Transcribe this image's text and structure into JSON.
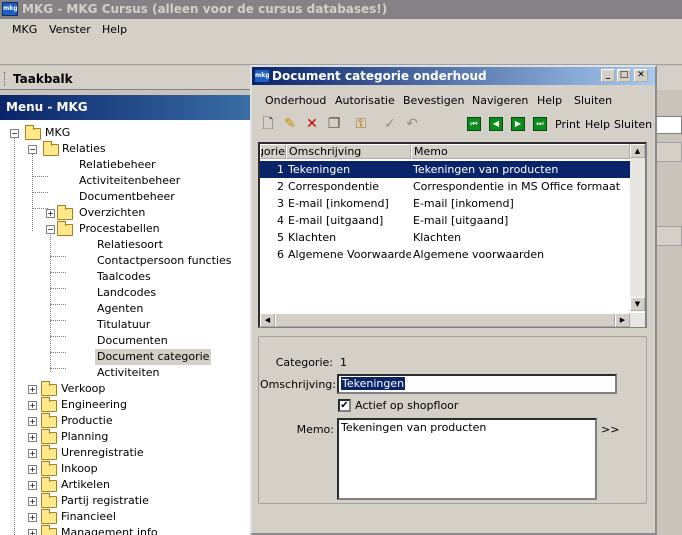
{
  "app": {
    "title": "MKG - MKG Cursus (alleen voor de cursus databases!)",
    "icon_label": "mkg",
    "menu": [
      "MKG",
      "Venster",
      "Help"
    ]
  },
  "taakbalk": {
    "title": "Taakbalk"
  },
  "left_menu": {
    "header": "Menu - MKG",
    "tree": [
      {
        "label": "MKG",
        "level": 0,
        "type": "folder",
        "expanded": true
      },
      {
        "label": "Relaties",
        "level": 1,
        "type": "folder",
        "expanded": true
      },
      {
        "label": "Relatiebeheer",
        "level": 2,
        "type": "item"
      },
      {
        "label": "Activiteitenbeheer",
        "level": 2,
        "type": "item"
      },
      {
        "label": "Documentbeheer",
        "level": 2,
        "type": "item"
      },
      {
        "label": "Overzichten",
        "level": 2,
        "type": "folder",
        "expanded": false
      },
      {
        "label": "Procestabellen",
        "level": 2,
        "type": "folder",
        "expanded": true
      },
      {
        "label": "Relatiesoort",
        "level": 3,
        "type": "item"
      },
      {
        "label": "Contactpersoon functies",
        "level": 3,
        "type": "item"
      },
      {
        "label": "Taalcodes",
        "level": 3,
        "type": "item"
      },
      {
        "label": "Landcodes",
        "level": 3,
        "type": "item"
      },
      {
        "label": "Agenten",
        "level": 3,
        "type": "item"
      },
      {
        "label": "Titulatuur",
        "level": 3,
        "type": "item"
      },
      {
        "label": "Documenten",
        "level": 3,
        "type": "item"
      },
      {
        "label": "Document categorie",
        "level": 3,
        "type": "item",
        "selected": true
      },
      {
        "label": "Activiteiten",
        "level": 3,
        "type": "item"
      },
      {
        "label": "Verkoop",
        "level": 1,
        "type": "folder",
        "expanded": false
      },
      {
        "label": "Engineering",
        "level": 1,
        "type": "folder",
        "expanded": false
      },
      {
        "label": "Productie",
        "level": 1,
        "type": "folder",
        "expanded": false
      },
      {
        "label": "Planning",
        "level": 1,
        "type": "folder",
        "expanded": false
      },
      {
        "label": "Urenregistratie",
        "level": 1,
        "type": "folder",
        "expanded": false
      },
      {
        "label": "Inkoop",
        "level": 1,
        "type": "folder",
        "expanded": false
      },
      {
        "label": "Artikelen",
        "level": 1,
        "type": "folder",
        "expanded": false
      },
      {
        "label": "Partij registratie",
        "level": 1,
        "type": "folder",
        "expanded": false
      },
      {
        "label": "Financieel",
        "level": 1,
        "type": "folder",
        "expanded": false
      },
      {
        "label": "Management info",
        "level": 1,
        "type": "folder",
        "expanded": false
      }
    ]
  },
  "dialog": {
    "title": "Document categorie onderhoud",
    "icon_label": "mkg",
    "menu": [
      "Onderhoud",
      "Autorisatie",
      "Bevestigen",
      "Navigeren",
      "Help",
      "Sluiten"
    ],
    "toolbar": {
      "icons": [
        {
          "name": "new-document-icon",
          "glyph": "🗋"
        },
        {
          "name": "edit-pencil-icon",
          "glyph": "✎"
        },
        {
          "name": "delete-x-icon",
          "glyph": "✕"
        },
        {
          "name": "copy-icon",
          "glyph": "❐"
        },
        {
          "name": "keys-icon",
          "glyph": "⚿"
        },
        {
          "name": "confirm-check-icon",
          "glyph": "✓"
        },
        {
          "name": "undo-icon",
          "glyph": "↶"
        }
      ],
      "nav": [
        {
          "name": "first-record-icon",
          "glyph": "⏮"
        },
        {
          "name": "prev-record-icon",
          "glyph": "◀"
        },
        {
          "name": "next-record-icon",
          "glyph": "▶"
        },
        {
          "name": "last-record-icon",
          "glyph": "⏭"
        }
      ],
      "print": "Print",
      "help": "Help",
      "close": "Sluiten"
    },
    "grid": {
      "columns": [
        "Categorie",
        "Omschrijving",
        "Memo"
      ],
      "rows": [
        {
          "nr": "1",
          "omschrijving": "Tekeningen",
          "memo": "Tekeningen van producten",
          "active": true
        },
        {
          "nr": "2",
          "omschrijving": "Correspondentie",
          "memo": "Correspondentie in MS Office formaat"
        },
        {
          "nr": "3",
          "omschrijving": "E-mail [inkomend]",
          "memo": "E-mail [inkomend]"
        },
        {
          "nr": "4",
          "omschrijving": "E-mail [uitgaand]",
          "memo": "E-mail [uitgaand]"
        },
        {
          "nr": "5",
          "omschrijving": "Klachten",
          "memo": "Klachten"
        },
        {
          "nr": "6",
          "omschrijving": "Algemene Voorwaarden/",
          "memo": "Algemene voorwaarden"
        }
      ]
    },
    "detail": {
      "categorie_label": "Categorie:",
      "categorie_value": "1",
      "omschrijving_label": "Omschrijving:",
      "omschrijving_value": "Tekeningen",
      "actief_label": "Actief op shopfloor",
      "actief_checked": "✔",
      "memo_label": "Memo:",
      "memo_value": "Tekeningen van producten",
      "expand_label": ">>"
    }
  }
}
